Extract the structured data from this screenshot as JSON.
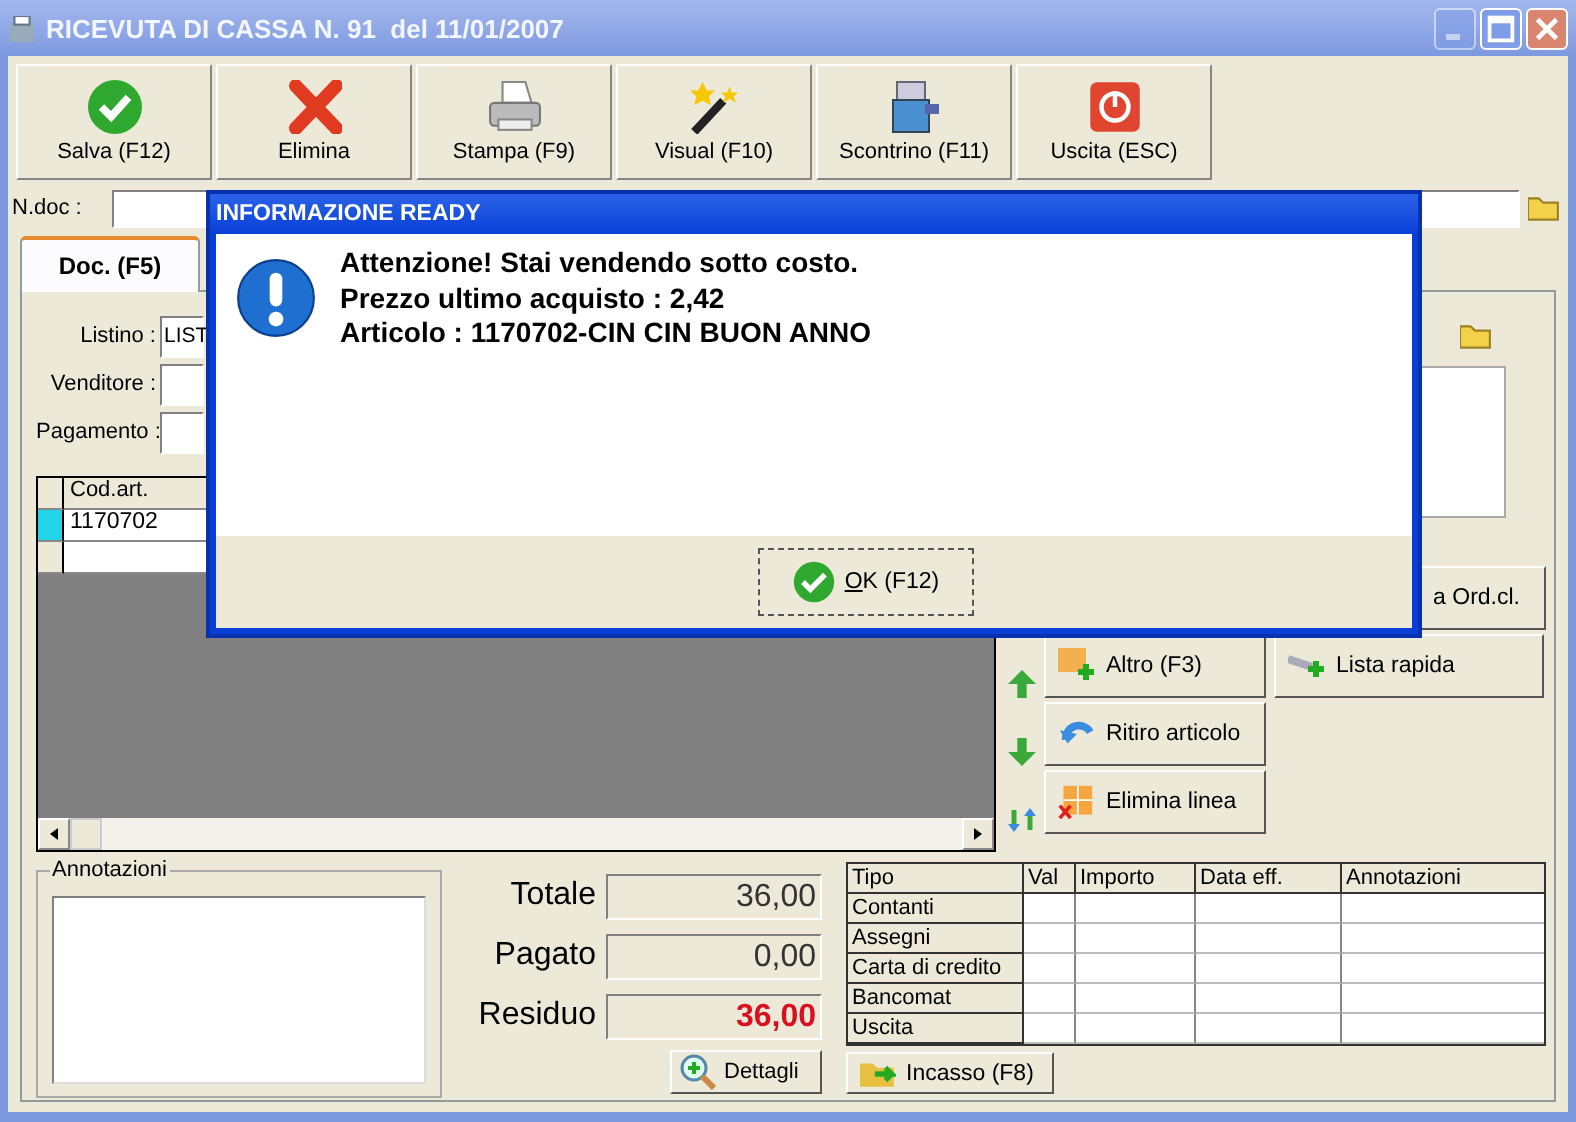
{
  "window": {
    "title": "RICEVUTA DI CASSA N. 91  del 11/01/2007"
  },
  "toolbar": [
    "Salva (F12)",
    "Elimina",
    "Stampa (F9)",
    "Visual (F10)",
    "Scontrino (F11)",
    "Uscita (ESC)"
  ],
  "header": {
    "ndoc_label": "N.doc :"
  },
  "tabs": [
    {
      "label": "Doc. (F5)",
      "selected": true
    }
  ],
  "form": [
    {
      "label": "Listino :",
      "value": "LIST"
    },
    {
      "label": "Venditore :"
    },
    {
      "label": "Pagamento :"
    }
  ],
  "items_grid": {
    "columns": [
      "Cod.art."
    ],
    "rows": [
      {
        "cod_art": "1170702",
        "selected": true
      },
      {
        "selected": false
      }
    ]
  },
  "side_buttons": [
    "a Ord.cl.",
    "Altro (F3)",
    "Lista rapida",
    "Ritiro articolo",
    "Elimina linea"
  ],
  "annotations": {
    "legend": "Annotazioni"
  },
  "totals": [
    {
      "label": "Totale",
      "value": "36,00",
      "highlighted": false
    },
    {
      "label": "Pagato",
      "value": "0,00",
      "highlighted": false
    },
    {
      "label": "Residuo",
      "value": "36,00",
      "highlighted": true
    }
  ],
  "details_button": "Dettagli",
  "payments": {
    "columns": [
      "Tipo",
      "Val",
      "Importo",
      "Data eff.",
      "Annotazioni"
    ],
    "rows": [
      "Contanti",
      "Assegni",
      "Carta di credito",
      "Bancomat",
      "Uscita"
    ]
  },
  "cash_button": "Incasso (F8)",
  "dialog": {
    "title": "INFORMAZIONE READY",
    "lines": [
      "Attenzione! Stai vendendo sotto costo.",
      "Prezzo ultimo acquisto : 2,42",
      "Articolo : 1170702-CIN CIN BUON ANNO"
    ],
    "ok_button": "OK (F12)"
  }
}
